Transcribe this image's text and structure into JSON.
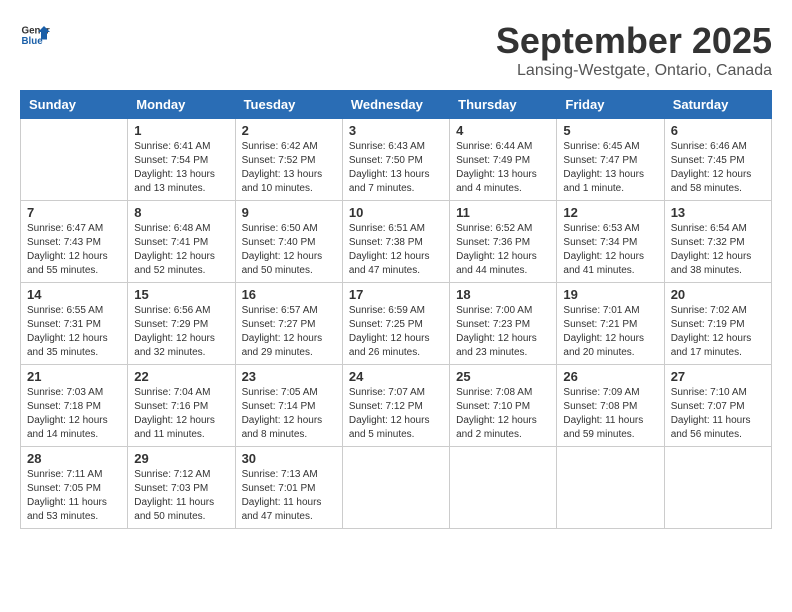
{
  "header": {
    "logo_line1": "General",
    "logo_line2": "Blue",
    "month_year": "September 2025",
    "location": "Lansing-Westgate, Ontario, Canada"
  },
  "weekdays": [
    "Sunday",
    "Monday",
    "Tuesday",
    "Wednesday",
    "Thursday",
    "Friday",
    "Saturday"
  ],
  "weeks": [
    [
      {
        "day": "",
        "sunrise": "",
        "sunset": "",
        "daylight": ""
      },
      {
        "day": "1",
        "sunrise": "Sunrise: 6:41 AM",
        "sunset": "Sunset: 7:54 PM",
        "daylight": "Daylight: 13 hours and 13 minutes."
      },
      {
        "day": "2",
        "sunrise": "Sunrise: 6:42 AM",
        "sunset": "Sunset: 7:52 PM",
        "daylight": "Daylight: 13 hours and 10 minutes."
      },
      {
        "day": "3",
        "sunrise": "Sunrise: 6:43 AM",
        "sunset": "Sunset: 7:50 PM",
        "daylight": "Daylight: 13 hours and 7 minutes."
      },
      {
        "day": "4",
        "sunrise": "Sunrise: 6:44 AM",
        "sunset": "Sunset: 7:49 PM",
        "daylight": "Daylight: 13 hours and 4 minutes."
      },
      {
        "day": "5",
        "sunrise": "Sunrise: 6:45 AM",
        "sunset": "Sunset: 7:47 PM",
        "daylight": "Daylight: 13 hours and 1 minute."
      },
      {
        "day": "6",
        "sunrise": "Sunrise: 6:46 AM",
        "sunset": "Sunset: 7:45 PM",
        "daylight": "Daylight: 12 hours and 58 minutes."
      }
    ],
    [
      {
        "day": "7",
        "sunrise": "Sunrise: 6:47 AM",
        "sunset": "Sunset: 7:43 PM",
        "daylight": "Daylight: 12 hours and 55 minutes."
      },
      {
        "day": "8",
        "sunrise": "Sunrise: 6:48 AM",
        "sunset": "Sunset: 7:41 PM",
        "daylight": "Daylight: 12 hours and 52 minutes."
      },
      {
        "day": "9",
        "sunrise": "Sunrise: 6:50 AM",
        "sunset": "Sunset: 7:40 PM",
        "daylight": "Daylight: 12 hours and 50 minutes."
      },
      {
        "day": "10",
        "sunrise": "Sunrise: 6:51 AM",
        "sunset": "Sunset: 7:38 PM",
        "daylight": "Daylight: 12 hours and 47 minutes."
      },
      {
        "day": "11",
        "sunrise": "Sunrise: 6:52 AM",
        "sunset": "Sunset: 7:36 PM",
        "daylight": "Daylight: 12 hours and 44 minutes."
      },
      {
        "day": "12",
        "sunrise": "Sunrise: 6:53 AM",
        "sunset": "Sunset: 7:34 PM",
        "daylight": "Daylight: 12 hours and 41 minutes."
      },
      {
        "day": "13",
        "sunrise": "Sunrise: 6:54 AM",
        "sunset": "Sunset: 7:32 PM",
        "daylight": "Daylight: 12 hours and 38 minutes."
      }
    ],
    [
      {
        "day": "14",
        "sunrise": "Sunrise: 6:55 AM",
        "sunset": "Sunset: 7:31 PM",
        "daylight": "Daylight: 12 hours and 35 minutes."
      },
      {
        "day": "15",
        "sunrise": "Sunrise: 6:56 AM",
        "sunset": "Sunset: 7:29 PM",
        "daylight": "Daylight: 12 hours and 32 minutes."
      },
      {
        "day": "16",
        "sunrise": "Sunrise: 6:57 AM",
        "sunset": "Sunset: 7:27 PM",
        "daylight": "Daylight: 12 hours and 29 minutes."
      },
      {
        "day": "17",
        "sunrise": "Sunrise: 6:59 AM",
        "sunset": "Sunset: 7:25 PM",
        "daylight": "Daylight: 12 hours and 26 minutes."
      },
      {
        "day": "18",
        "sunrise": "Sunrise: 7:00 AM",
        "sunset": "Sunset: 7:23 PM",
        "daylight": "Daylight: 12 hours and 23 minutes."
      },
      {
        "day": "19",
        "sunrise": "Sunrise: 7:01 AM",
        "sunset": "Sunset: 7:21 PM",
        "daylight": "Daylight: 12 hours and 20 minutes."
      },
      {
        "day": "20",
        "sunrise": "Sunrise: 7:02 AM",
        "sunset": "Sunset: 7:19 PM",
        "daylight": "Daylight: 12 hours and 17 minutes."
      }
    ],
    [
      {
        "day": "21",
        "sunrise": "Sunrise: 7:03 AM",
        "sunset": "Sunset: 7:18 PM",
        "daylight": "Daylight: 12 hours and 14 minutes."
      },
      {
        "day": "22",
        "sunrise": "Sunrise: 7:04 AM",
        "sunset": "Sunset: 7:16 PM",
        "daylight": "Daylight: 12 hours and 11 minutes."
      },
      {
        "day": "23",
        "sunrise": "Sunrise: 7:05 AM",
        "sunset": "Sunset: 7:14 PM",
        "daylight": "Daylight: 12 hours and 8 minutes."
      },
      {
        "day": "24",
        "sunrise": "Sunrise: 7:07 AM",
        "sunset": "Sunset: 7:12 PM",
        "daylight": "Daylight: 12 hours and 5 minutes."
      },
      {
        "day": "25",
        "sunrise": "Sunrise: 7:08 AM",
        "sunset": "Sunset: 7:10 PM",
        "daylight": "Daylight: 12 hours and 2 minutes."
      },
      {
        "day": "26",
        "sunrise": "Sunrise: 7:09 AM",
        "sunset": "Sunset: 7:08 PM",
        "daylight": "Daylight: 11 hours and 59 minutes."
      },
      {
        "day": "27",
        "sunrise": "Sunrise: 7:10 AM",
        "sunset": "Sunset: 7:07 PM",
        "daylight": "Daylight: 11 hours and 56 minutes."
      }
    ],
    [
      {
        "day": "28",
        "sunrise": "Sunrise: 7:11 AM",
        "sunset": "Sunset: 7:05 PM",
        "daylight": "Daylight: 11 hours and 53 minutes."
      },
      {
        "day": "29",
        "sunrise": "Sunrise: 7:12 AM",
        "sunset": "Sunset: 7:03 PM",
        "daylight": "Daylight: 11 hours and 50 minutes."
      },
      {
        "day": "30",
        "sunrise": "Sunrise: 7:13 AM",
        "sunset": "Sunset: 7:01 PM",
        "daylight": "Daylight: 11 hours and 47 minutes."
      },
      {
        "day": "",
        "sunrise": "",
        "sunset": "",
        "daylight": ""
      },
      {
        "day": "",
        "sunrise": "",
        "sunset": "",
        "daylight": ""
      },
      {
        "day": "",
        "sunrise": "",
        "sunset": "",
        "daylight": ""
      },
      {
        "day": "",
        "sunrise": "",
        "sunset": "",
        "daylight": ""
      }
    ]
  ]
}
